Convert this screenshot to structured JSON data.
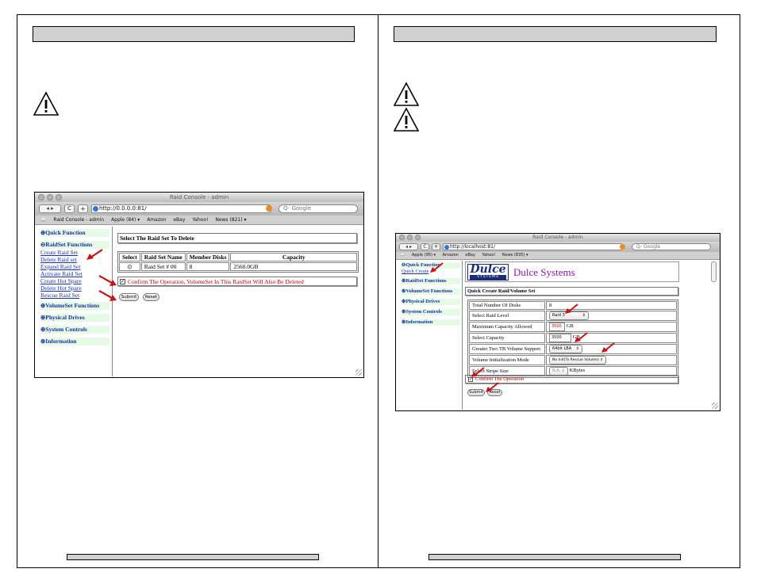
{
  "left_page": {
    "screenshot": {
      "window_title": "Raid Console - admin",
      "url": "http://0.0.0.0:81/",
      "search_placeholder": "Q- Google",
      "bookmarks": [
        "Raid Console - admin",
        "Apple (84) ▾",
        "Amazon",
        "eBay",
        "Yahoo!",
        "News (821) ▾"
      ],
      "sidebar": {
        "quick_function": "⊕Quick Function",
        "raidset_functions": "⊖RaidSet Functions",
        "sub_links": [
          "Create Raid Set",
          "Delete Raid set",
          "Expand Raid Set",
          "Activate Raid Set",
          "Create Hot Spare",
          "Delete Hot Spare",
          "Rescue Raid Set"
        ],
        "volumeset_functions": "⊕VolumeSet Functions",
        "physical_drives": "⊕Physical Drives",
        "system_controls": "⊕System Controls",
        "information": "⊕Information"
      },
      "content": {
        "title": "Select The Raid Set To Delete",
        "table_headers": [
          "Select",
          "Raid Set Name",
          "Member Disks",
          "Capacity"
        ],
        "table_rows": [
          {
            "select": "⊙",
            "name": "Raid Set # 00",
            "disks": "8",
            "capacity": "2560.0GB"
          }
        ],
        "confirm_label": "Confirm The Operation, VolumeSet In This RaidSet Will Also Be Deleted",
        "submit_label": "Submit",
        "reset_label": "Reset"
      }
    }
  },
  "right_page": {
    "screenshot": {
      "window_title": "Raid Console - admin",
      "url": "http://localhost:81/",
      "search_placeholder": "Q- Google",
      "bookmarks": [
        "Apple (95) ▾",
        "Amazon",
        "eBay",
        "Yahoo!",
        "News (835) ▾"
      ],
      "sidebar": {
        "quick_function": "⊖Quick Function",
        "quick_create": "Quick Create",
        "raidset_functions": "⊕RaidSet Functions",
        "volumeset_functions": "⊕VolumeSet Functions",
        "physical_drives": "⊕Physical Drives",
        "system_controls": "⊕System Controls",
        "information": "⊕Information"
      },
      "content": {
        "logo_text": "Dulce",
        "logo_sub": "SYSTEMS",
        "brand_name": "Dulce Systems",
        "title": "Quick Create Raid/Volume Set",
        "rows": [
          {
            "label": "Total Number Of Disks",
            "value": "8"
          },
          {
            "label": "Select Raid Level",
            "value": "Raid 3"
          },
          {
            "label": "Maximum Capacity Allowed",
            "value": "3500",
            "unit": "GB"
          },
          {
            "label": "Select Capacity",
            "value": "3500",
            "unit": "GB"
          },
          {
            "label": "Greater Two TB Volume Support",
            "value": "64bit LBA"
          },
          {
            "label": "Volume Initialization Mode",
            "value": "No Init(To Rescue Volume)"
          },
          {
            "label": "Select Stripe Size",
            "value": "N.A.",
            "unit": "KBytes"
          }
        ],
        "confirm_label": "Confirm The Operation",
        "submit_label": "Submit",
        "reset_label": "Reset"
      }
    }
  },
  "colors": {
    "link_blue": "#1530a0",
    "menu_bg": "#e6fbe6",
    "confirm_red": "#c00000",
    "arrow_red": "#cc1111",
    "brand_purple": "#8a1aa8",
    "header_gray": "#d0d0d0"
  }
}
